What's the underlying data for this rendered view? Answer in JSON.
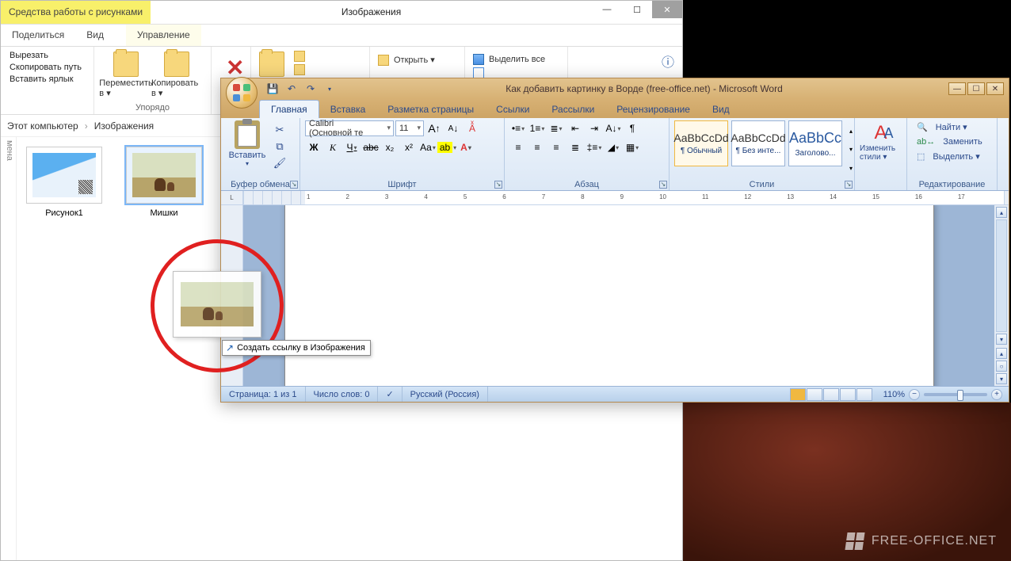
{
  "explorer": {
    "contextual_tab": "Средства работы с рисунками",
    "title": "Изображения",
    "tabs": {
      "share": "Поделиться",
      "view": "Вид",
      "manage": "Управление"
    },
    "clipboard": {
      "cut": "Вырезать",
      "copypath": "Скопировать путь",
      "pastelnk": "Вставить ярлык"
    },
    "organize": {
      "moveto": "Переместить в ▾",
      "copyto": "Копировать в ▾",
      "group": "Упорядо"
    },
    "open_group": {
      "open": "Открыть ▾"
    },
    "select_group": {
      "selectall": "Выделить все"
    },
    "breadcrumb": {
      "root": "Этот компьютер",
      "folder": "Изображения"
    },
    "navlabel": "мена",
    "files": {
      "pic1": "Рисунок1",
      "bears": "Мишки"
    }
  },
  "word": {
    "title": "Как добавить картинку в Ворде (free-office.net) - Microsoft Word",
    "tabs": {
      "home": "Главная",
      "insert": "Вставка",
      "layout": "Разметка страницы",
      "refs": "Ссылки",
      "mail": "Рассылки",
      "review": "Рецензирование",
      "view": "Вид"
    },
    "clipboard": {
      "paste": "Вставить",
      "group": "Буфер обмена"
    },
    "font": {
      "name": "Calibri (Основной те",
      "size": "11",
      "group": "Шрифт",
      "b": "Ж",
      "i": "К",
      "u": "Ч",
      "s": "abc",
      "sub": "x₂",
      "sup": "x²",
      "case": "Aa",
      "clear": "A",
      "grow": "A",
      "shrink": "A",
      "hl": "ab",
      "color": "A"
    },
    "para": {
      "group": "Абзац"
    },
    "styles": {
      "group": "Стили",
      "s1": {
        "prev": "AaBbCcDd",
        "name": "¶ Обычный"
      },
      "s2": {
        "prev": "AaBbCcDd",
        "name": "¶ Без инте..."
      },
      "s3": {
        "prev": "AaBbCc",
        "name": "Заголово..."
      },
      "change": "Изменить стили ▾"
    },
    "editing": {
      "group": "Редактирование",
      "find": "Найти ▾",
      "replace": "Заменить",
      "select": "Выделить ▾"
    },
    "ruler_nums": [
      "1",
      "2",
      "3",
      "4",
      "5",
      "6",
      "7",
      "8",
      "9",
      "10",
      "11",
      "12",
      "13",
      "14",
      "15",
      "16",
      "17"
    ],
    "status": {
      "page": "Страница: 1 из 1",
      "words": "Число слов: 0",
      "lang": "Русский (Россия)",
      "zoom": "110%"
    }
  },
  "drag": {
    "tooltip": "Создать ссылку в Изображения"
  },
  "watermark": "FREE-OFFICE.NET"
}
